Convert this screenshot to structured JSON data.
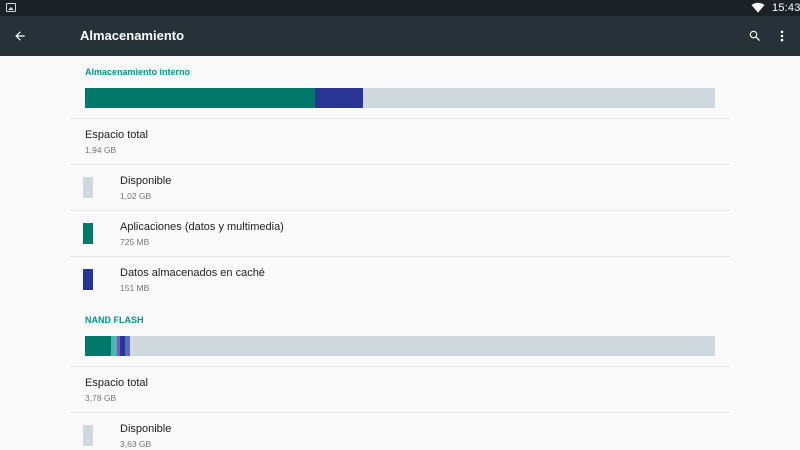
{
  "status_bar": {
    "time": "15:43",
    "icons": [
      "image-icon",
      "wifi-icon"
    ]
  },
  "app_bar": {
    "title": "Almacenamiento",
    "icons": [
      "back-arrow-icon",
      "search-icon",
      "more-vert-icon"
    ]
  },
  "colors": {
    "accent": "#009688",
    "apps": "#00796b",
    "cache": "#283593",
    "free": "#cfd8dc",
    "toolbar": "#263238",
    "statusbar": "#1c2125"
  },
  "internal": {
    "header": "Almacenamiento interno",
    "usage_fraction": {
      "apps": 0.365,
      "cache": 0.077,
      "free": 0.558
    },
    "total_label": "Espacio total",
    "total_value": "1,94 GB",
    "items": [
      {
        "label": "Disponible",
        "value": "1,02 GB",
        "color": "#cfd8dc"
      },
      {
        "label": "Aplicaciones (datos y multimedia)",
        "value": "725 MB",
        "color": "#00796b"
      },
      {
        "label": "Datos almacenados en caché",
        "value": "151 MB",
        "color": "#283593"
      }
    ]
  },
  "nand": {
    "header": "NAND FLASH",
    "usage_fraction": {
      "seg1": 0.041,
      "seg2": 0.01,
      "seg3": 0.005,
      "seg4": 0.008,
      "seg5": 0.008,
      "free": 0.928
    },
    "segment_colors": [
      "#00796b",
      "#4db6ac",
      "#7e57c2",
      "#283593",
      "#5c6bc0"
    ],
    "total_label": "Espacio total",
    "total_value": "3,78 GB",
    "items": [
      {
        "label": "Disponible",
        "value": "3,63 GB",
        "color": "#cfd8dc"
      }
    ]
  }
}
